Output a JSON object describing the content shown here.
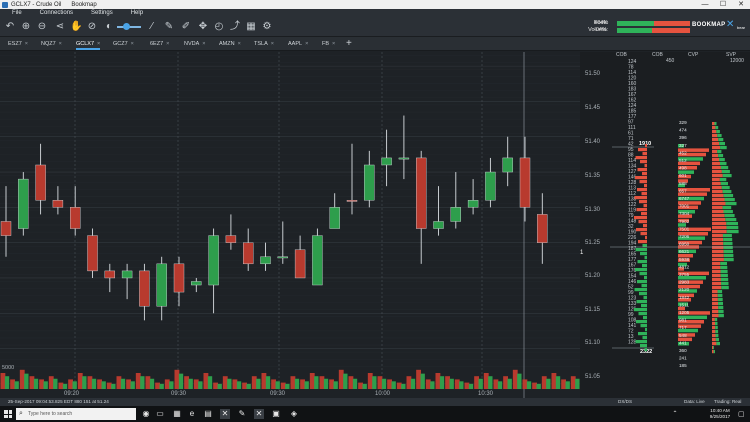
{
  "window": {
    "title_left": "GCLX7 - Crude Oil",
    "title_right": "Bookmap",
    "controls": [
      "—",
      "☐",
      "✕"
    ]
  },
  "menu": [
    "File",
    "Connections",
    "Settings",
    "Help"
  ],
  "toolbar": {
    "icons": [
      "undo-icon",
      "zoom-in-icon",
      "zoom-out-icon",
      "share-icon",
      "hand-icon",
      "brightness-icon",
      "eyedropper-icon",
      "brush-icon",
      "pencil-icon",
      "crosshair-icon",
      "alarm-icon",
      "chart-line-icon",
      "calculator-icon",
      "gear-icon"
    ],
    "book_label": "Book:",
    "book_value": "+04%",
    "volume_label": "Volume:",
    "volume_value": "-04%",
    "brand": "BOOKMAP",
    "brand_small": "bear"
  },
  "tabs": [
    {
      "label": "ESZ7",
      "active": false
    },
    {
      "label": "NQZ7",
      "active": false
    },
    {
      "label": "GCLX7",
      "active": true
    },
    {
      "label": "GCZ7",
      "active": false
    },
    {
      "label": "6EZ7",
      "active": false
    },
    {
      "label": "NVDA",
      "active": false
    },
    {
      "label": "AMZN",
      "active": false
    },
    {
      "label": "TSLA",
      "active": false
    },
    {
      "label": "AAPL",
      "active": false
    },
    {
      "label": "FB",
      "active": false
    }
  ],
  "columns": {
    "cob1": "COB",
    "cob2": "COB",
    "cvp": "CVP",
    "svp": "SVP",
    "cob_value": "450",
    "svp_value": "12000"
  },
  "axis": {
    "price_labels": [
      "51.50",
      "51.45",
      "51.40",
      "51.35",
      "51.30",
      "51.25",
      "51.20",
      "51.15",
      "51.10",
      "51.05"
    ],
    "price_marker": "1",
    "time_labels": [
      "09:20",
      "09:30",
      "09:30",
      "10:00",
      "10:30"
    ],
    "volume_label": "5000"
  },
  "chart_data": {
    "type": "candlestick",
    "candles": [
      {
        "o": 51.28,
        "h": 51.33,
        "l": 51.23,
        "c": 51.26,
        "dir": "down"
      },
      {
        "o": 51.27,
        "h": 51.35,
        "l": 51.26,
        "c": 51.34,
        "dir": "up"
      },
      {
        "o": 51.36,
        "h": 51.39,
        "l": 51.29,
        "c": 51.31,
        "dir": "down"
      },
      {
        "o": 51.31,
        "h": 51.33,
        "l": 51.29,
        "c": 51.3,
        "dir": "down"
      },
      {
        "o": 51.3,
        "h": 51.33,
        "l": 51.26,
        "c": 51.27,
        "dir": "down"
      },
      {
        "o": 51.26,
        "h": 51.27,
        "l": 51.2,
        "c": 51.21,
        "dir": "down"
      },
      {
        "o": 51.21,
        "h": 51.22,
        "l": 51.18,
        "c": 51.2,
        "dir": "down"
      },
      {
        "o": 51.2,
        "h": 51.22,
        "l": 51.17,
        "c": 51.21,
        "dir": "up"
      },
      {
        "o": 51.21,
        "h": 51.22,
        "l": 51.14,
        "c": 51.16,
        "dir": "down"
      },
      {
        "o": 51.16,
        "h": 51.23,
        "l": 51.14,
        "c": 51.22,
        "dir": "up"
      },
      {
        "o": 51.22,
        "h": 51.23,
        "l": 51.16,
        "c": 51.18,
        "dir": "down"
      },
      {
        "o": 51.19,
        "h": 51.2,
        "l": 51.18,
        "c": 51.195,
        "dir": "up"
      },
      {
        "o": 51.19,
        "h": 51.27,
        "l": 51.15,
        "c": 51.26,
        "dir": "up"
      },
      {
        "o": 51.25,
        "h": 51.29,
        "l": 51.24,
        "c": 51.26,
        "dir": "down"
      },
      {
        "o": 51.25,
        "h": 51.27,
        "l": 51.21,
        "c": 51.22,
        "dir": "down"
      },
      {
        "o": 51.22,
        "h": 51.25,
        "l": 51.21,
        "c": 51.23,
        "dir": "up"
      },
      {
        "o": 51.23,
        "h": 51.28,
        "l": 51.22,
        "c": 51.23,
        "dir": "up"
      },
      {
        "o": 51.24,
        "h": 51.26,
        "l": 51.2,
        "c": 51.2,
        "dir": "down"
      },
      {
        "o": 51.19,
        "h": 51.27,
        "l": 51.19,
        "c": 51.26,
        "dir": "up"
      },
      {
        "o": 51.27,
        "h": 51.32,
        "l": 51.27,
        "c": 51.3,
        "dir": "up"
      },
      {
        "o": 51.31,
        "h": 51.39,
        "l": 51.29,
        "c": 51.31,
        "dir": "down"
      },
      {
        "o": 51.31,
        "h": 51.38,
        "l": 51.3,
        "c": 51.36,
        "dir": "up"
      },
      {
        "o": 51.36,
        "h": 51.41,
        "l": 51.33,
        "c": 51.37,
        "dir": "up"
      },
      {
        "o": 51.37,
        "h": 51.43,
        "l": 51.34,
        "c": 51.37,
        "dir": "up"
      },
      {
        "o": 51.37,
        "h": 51.38,
        "l": 51.22,
        "c": 51.27,
        "dir": "down"
      },
      {
        "o": 51.27,
        "h": 51.33,
        "l": 51.26,
        "c": 51.28,
        "dir": "up"
      },
      {
        "o": 51.28,
        "h": 51.35,
        "l": 51.27,
        "c": 51.3,
        "dir": "up"
      },
      {
        "o": 51.3,
        "h": 51.34,
        "l": 51.29,
        "c": 51.31,
        "dir": "up"
      },
      {
        "o": 51.31,
        "h": 51.37,
        "l": 51.3,
        "c": 51.35,
        "dir": "up"
      },
      {
        "o": 51.35,
        "h": 51.4,
        "l": 51.33,
        "c": 51.37,
        "dir": "up"
      },
      {
        "o": 51.37,
        "h": 51.4,
        "l": 51.28,
        "c": 51.3,
        "dir": "down"
      },
      {
        "o": 51.29,
        "h": 51.32,
        "l": 51.22,
        "c": 51.25,
        "dir": "down"
      }
    ],
    "volume": [
      5,
      3,
      6,
      4,
      3,
      4,
      2,
      3,
      5,
      4,
      3,
      2,
      4,
      3,
      5,
      4,
      2,
      3,
      6,
      4,
      3,
      5,
      2,
      4,
      3,
      2,
      4,
      5,
      3,
      2,
      4,
      3,
      5,
      4,
      3,
      6,
      4,
      2,
      5,
      4,
      3,
      2,
      4,
      6,
      3,
      5,
      4,
      3,
      2,
      4,
      5,
      3,
      4,
      6,
      3,
      2,
      4,
      5,
      3,
      4
    ]
  },
  "cob_numbers": [
    "124",
    "78",
    "114",
    "120",
    "160",
    "183",
    "167",
    "162",
    "124",
    "185",
    "177",
    "97",
    "111",
    "61",
    "71",
    "42",
    "95",
    "88",
    "114",
    "134",
    "127",
    "146",
    "128",
    "113",
    "112",
    "138",
    "122",
    "119",
    "79",
    "148",
    "32",
    "190",
    "226",
    "194",
    "187",
    "165",
    "177",
    "167",
    "176",
    "154",
    "146",
    "52",
    "99",
    "123",
    "133",
    "126",
    "99",
    "108",
    "141",
    "72",
    "13",
    "128"
  ],
  "cob_highlight": "1910",
  "cob_total": "2322",
  "cvp_numbers": [
    "329",
    "474",
    "396",
    "327",
    "452",
    "512",
    "498",
    "601",
    "588",
    "657",
    "6747",
    "7001",
    "7304",
    "7902",
    "7501",
    "7206",
    "6950",
    "6621",
    "5938",
    "4812",
    "3755",
    "2983",
    "2120",
    "1842",
    "1511",
    "1205",
    "981",
    "717",
    "548",
    "441",
    "360",
    "241",
    "185"
  ],
  "status": {
    "left": "25-Sep-2017 09:04:53.825 EDT      880 151 at 51.24",
    "mid": "DX/DS",
    "right1": "Data: Live",
    "right2": "Trading: Real"
  },
  "taskbar": {
    "search_placeholder": "Type here to search",
    "time": "10:40 AM",
    "date": "9/25/2017"
  }
}
